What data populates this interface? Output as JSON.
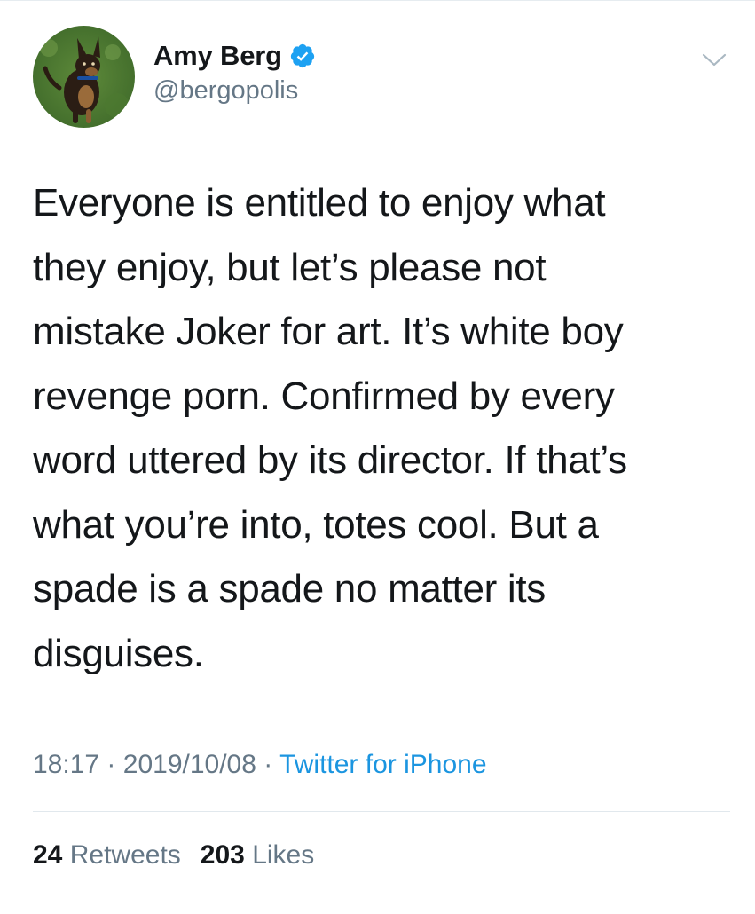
{
  "author": {
    "display_name": "Amy Berg",
    "handle": "@bergopolis",
    "verified": true,
    "avatar": "dog-photo-avatar"
  },
  "tweet": {
    "text": "Everyone is entitled to enjoy what\nthey enjoy, but let’s please not\nmistake Joker for art. It’s white boy\nrevenge porn. Confirmed by every\nword uttered by its director. If that’s\nwhat you’re into, totes cool. But a\nspade is a spade no matter its\ndisguises.",
    "time": "18:17",
    "date": "2019/10/08",
    "source": "Twitter for iPhone",
    "separator": "·"
  },
  "stats": {
    "retweets_count": "24",
    "retweets_label": "Retweets",
    "likes_count": "203",
    "likes_label": "Likes"
  },
  "icons": {
    "verified": "verified-badge-icon",
    "menu": "chevron-down-icon"
  },
  "colors": {
    "link": "#1b95e0",
    "secondary_text": "#657786",
    "primary_text": "#14171a",
    "verified": "#1da1f2"
  }
}
